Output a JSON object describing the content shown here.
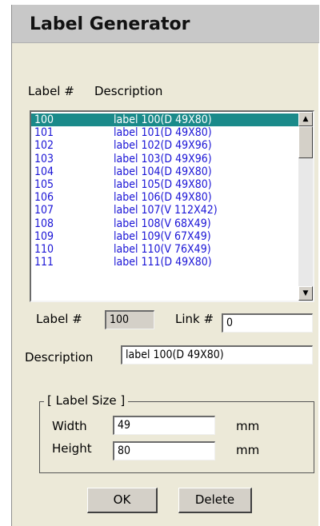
{
  "window": {
    "title": "Label Generator"
  },
  "list": {
    "col_label": "Label #",
    "col_description": "Description",
    "rows": [
      {
        "num": "100",
        "desc": "label 100(D 49X80)"
      },
      {
        "num": "101",
        "desc": "label 101(D 49X80)"
      },
      {
        "num": "102",
        "desc": "label 102(D 49X96)"
      },
      {
        "num": "103",
        "desc": "label 103(D 49X96)"
      },
      {
        "num": "104",
        "desc": "label 104(D 49X80)"
      },
      {
        "num": "105",
        "desc": "label 105(D 49X80)"
      },
      {
        "num": "106",
        "desc": "label 106(D 49X80)"
      },
      {
        "num": "107",
        "desc": "label 107(V 112X42)"
      },
      {
        "num": "108",
        "desc": "label 108(V 68X49)"
      },
      {
        "num": "109",
        "desc": "label 109(V 67X49)"
      },
      {
        "num": "110",
        "desc": "label 110(V 76X49)"
      },
      {
        "num": "111",
        "desc": "label 111(D 49X80)"
      }
    ],
    "selected_index": 0,
    "scroll_up_icon": "▲",
    "scroll_down_icon": "▼"
  },
  "form": {
    "label_num_caption": "Label #",
    "label_num_value": "100",
    "link_caption": "Link #",
    "link_value": "0",
    "description_caption": "Description",
    "description_value": "label 100(D 49X80)",
    "size_group_title": "[ Label Size ]",
    "width_caption": "Width",
    "width_value": "49",
    "width_unit": "mm",
    "height_caption": "Height",
    "height_value": "80",
    "height_unit": "mm"
  },
  "buttons": {
    "ok": "OK",
    "delete": "Delete"
  }
}
